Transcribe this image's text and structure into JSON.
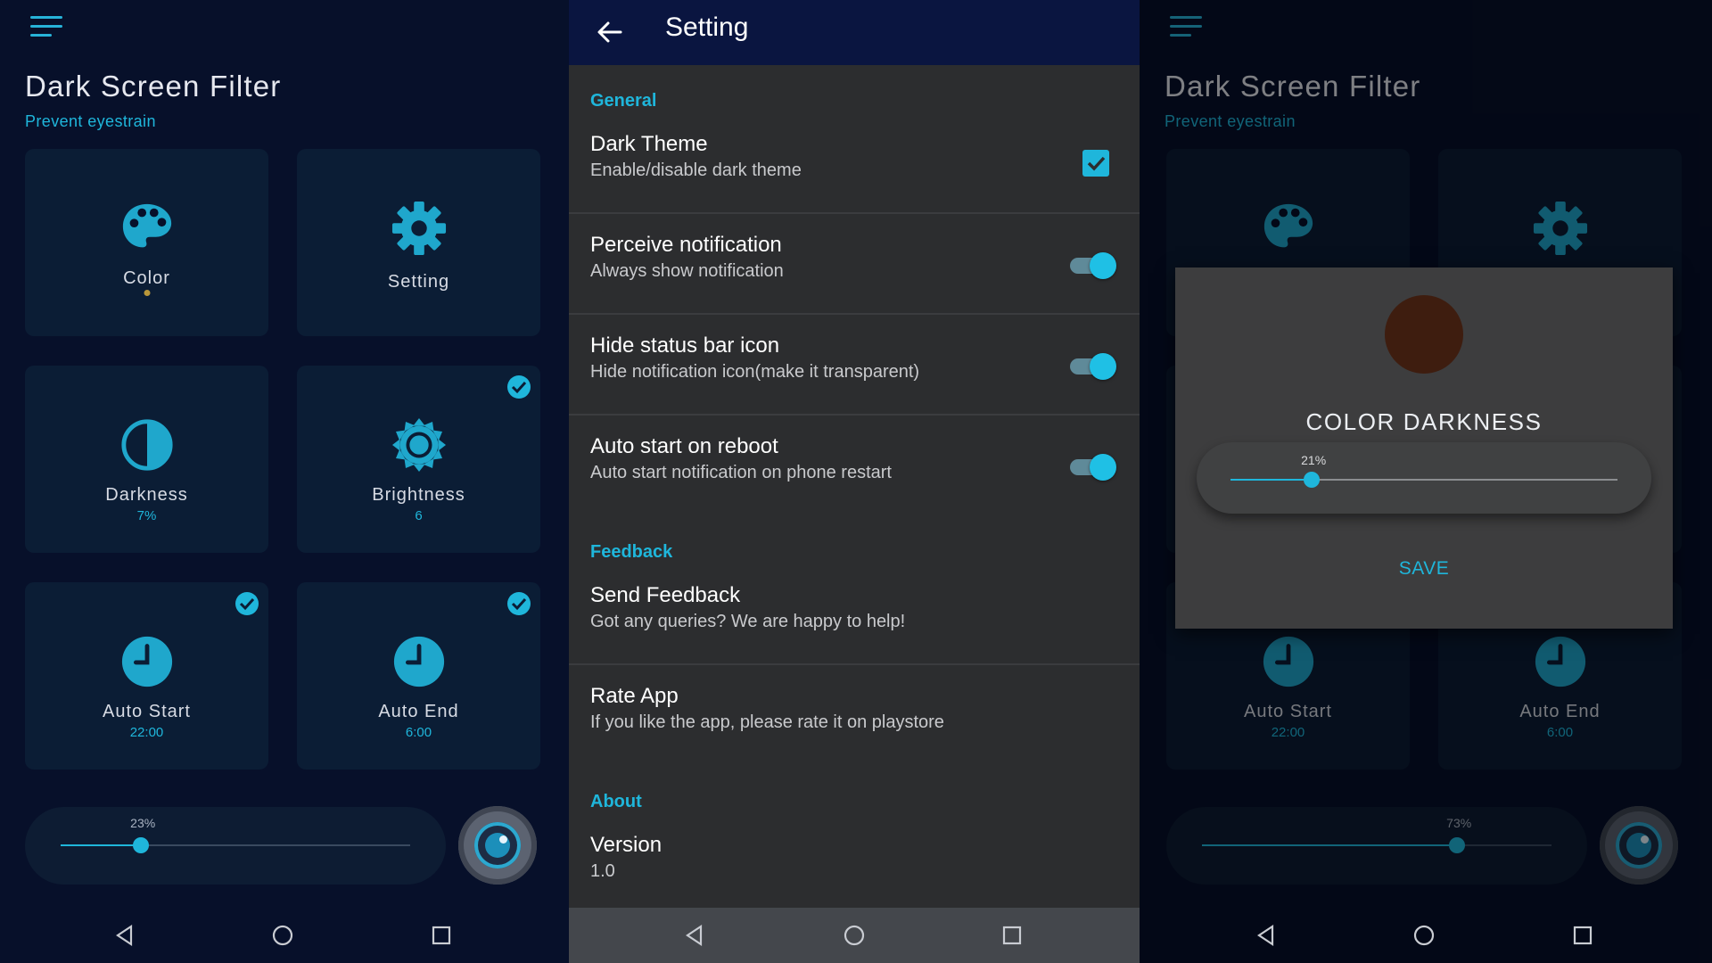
{
  "home": {
    "title": "Dark Screen Filter",
    "subtitle": "Prevent eyestrain",
    "tiles": [
      {
        "label": "Color",
        "value": ""
      },
      {
        "label": "Setting",
        "value": ""
      },
      {
        "label": "Darkness",
        "value": "7%"
      },
      {
        "label": "Brightness",
        "value": "6"
      },
      {
        "label": "Auto Start",
        "value": "22:00"
      },
      {
        "label": "Auto End",
        "value": "6:00"
      }
    ],
    "slider_percent_label": "23%",
    "slider_fraction": 0.23
  },
  "settings": {
    "title": "Setting",
    "section_general": "General",
    "section_feedback": "Feedback",
    "section_about": "About",
    "items": [
      {
        "title": "Dark Theme",
        "subtitle": "Enable/disable dark theme"
      },
      {
        "title": "Perceive notification",
        "subtitle": "Always show notification"
      },
      {
        "title": "Hide status bar icon",
        "subtitle": "Hide notification icon(make it transparent)"
      },
      {
        "title": "Auto start on reboot",
        "subtitle": "Auto start notification on phone restart"
      },
      {
        "title": "Send Feedback",
        "subtitle": "Got any queries? We are happy to help!"
      },
      {
        "title": "Rate App",
        "subtitle": "If you like the app, please rate it on playstore"
      },
      {
        "title": "Version",
        "subtitle": "1.0"
      }
    ]
  },
  "dialog_screen": {
    "title": "Dark Screen Filter",
    "subtitle": "Prevent eyestrain",
    "tiles": [
      {
        "label": "Auto Start",
        "value": "22:00"
      },
      {
        "label": "Auto End",
        "value": "6:00"
      }
    ],
    "slider_percent_label": "73%",
    "slider_fraction": 0.73,
    "dialog": {
      "title": "COLOR DARKNESS",
      "percent_label": "21%",
      "fraction": 0.21,
      "save_label": "SAVE",
      "swatch_color": "#3e1d0f"
    }
  },
  "colors": {
    "accent": "#1fb6db",
    "tile": "#0b1d35",
    "background": "#07102a"
  }
}
